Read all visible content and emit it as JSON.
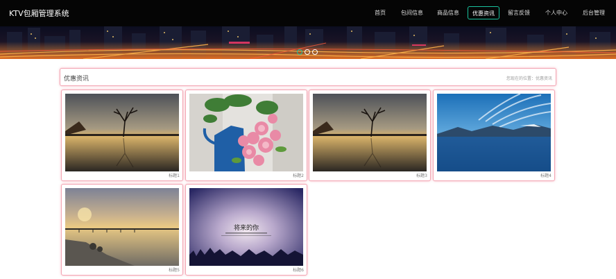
{
  "header": {
    "brand": "KTV包厢管理系统",
    "nav": [
      {
        "label": "首页",
        "active": false
      },
      {
        "label": "包间信息",
        "active": false
      },
      {
        "label": "商品信息",
        "active": false
      },
      {
        "label": "优惠资讯",
        "active": true
      },
      {
        "label": "留言反馈",
        "active": false
      },
      {
        "label": "个人中心",
        "active": false
      },
      {
        "label": "后台管理",
        "active": false
      }
    ]
  },
  "banner": {
    "slides": 3,
    "active_slide": 0
  },
  "section": {
    "title": "优惠资讯",
    "breadcrumb": "您现在的位置：优惠资讯"
  },
  "cards": [
    {
      "caption": "标题1",
      "image": "lake-tree-sunset"
    },
    {
      "caption": "标题2",
      "image": "pink-roses-blue-watering-can"
    },
    {
      "caption": "标题3",
      "image": "lake-tree-sunset"
    },
    {
      "caption": "标题4",
      "image": "blue-lake-mountains"
    },
    {
      "caption": "标题5",
      "image": "river-bridge-dusk"
    },
    {
      "caption": "标题6",
      "image": "purple-sky-poster"
    }
  ],
  "image_texts": {
    "poster_heading": "将来的你"
  },
  "colors": {
    "accent": "#19c39e",
    "card_border": "#f3a6b4",
    "header_bg": "#050505"
  }
}
